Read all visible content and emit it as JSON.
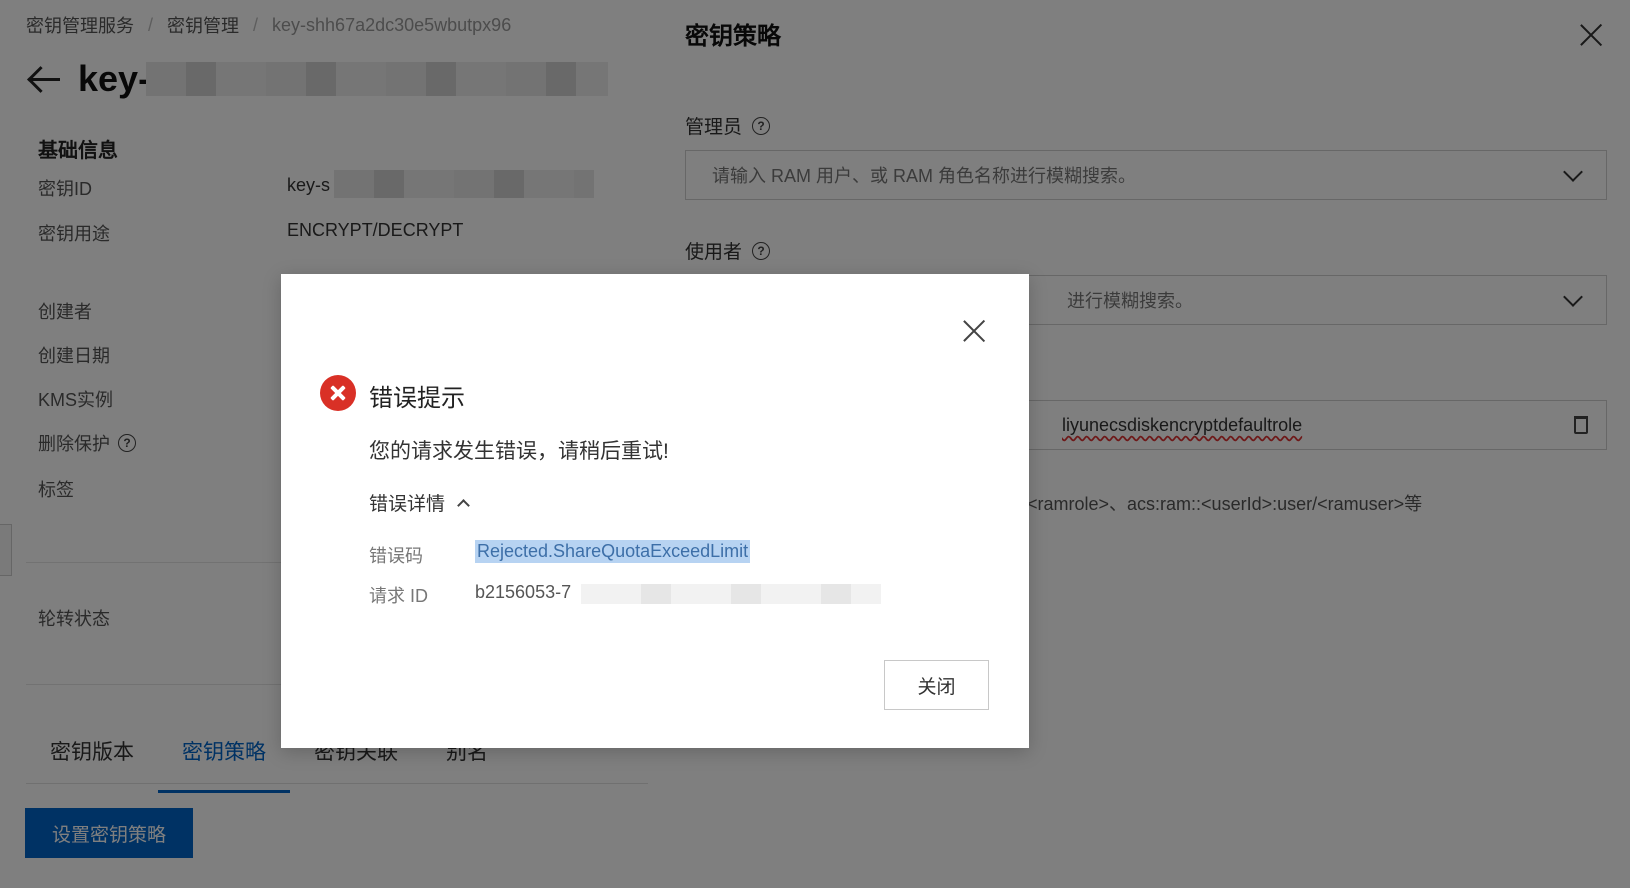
{
  "breadcrumb": {
    "items": [
      "密钥管理服务",
      "密钥管理",
      "key-shh67a2dc30e5wbutpx96"
    ]
  },
  "detail": {
    "title": "key-",
    "section_title": "基础信息",
    "rows": [
      {
        "label": "密钥ID",
        "value": "key-s"
      },
      {
        "label": "密钥用途",
        "value": "ENCRYPT/DECRYPT"
      },
      {
        "label": "创建者",
        "value": ""
      },
      {
        "label": "创建日期",
        "value": ""
      },
      {
        "label": "KMS实例",
        "value": ""
      },
      {
        "label": "删除保护",
        "value": ""
      },
      {
        "label": "标签",
        "value": ""
      }
    ],
    "rotation_label": "轮转状态",
    "tabs": [
      "密钥版本",
      "密钥策略",
      "密钥关联",
      "别名"
    ],
    "active_tab": "密钥策略",
    "set_policy_button": "设置密钥策略"
  },
  "drawer": {
    "title": "密钥策略",
    "admin_label": "管理员",
    "admin_placeholder": "请输入 RAM 用户、或 RAM 角色名称进行模糊搜索。",
    "user_label": "使用者",
    "user_placeholder_visible": "进行模糊搜索。",
    "selected_role_visible": "liyunecsdiskencryptdefaultrole",
    "hint_visible": "<ramrole>、acs:ram::<userId>:user/<ramuser>等"
  },
  "modal": {
    "title": "错误提示",
    "message": "您的请求发生错误，请稍后重试!",
    "details_toggle": "错误详情",
    "error_code_label": "错误码",
    "error_code": "Rejected.ShareQuotaExceedLimit",
    "request_id_label": "请求 ID",
    "request_id": "b2156053-7",
    "close_button": "关闭"
  },
  "colors": {
    "primary": "#0064c8",
    "error": "#d93026",
    "highlight": "#b7d3f2"
  },
  "icons": [
    "back-arrow-icon",
    "help-icon",
    "close-icon",
    "chevron-down-icon",
    "delete-icon",
    "error-icon",
    "chevron-up-icon"
  ]
}
